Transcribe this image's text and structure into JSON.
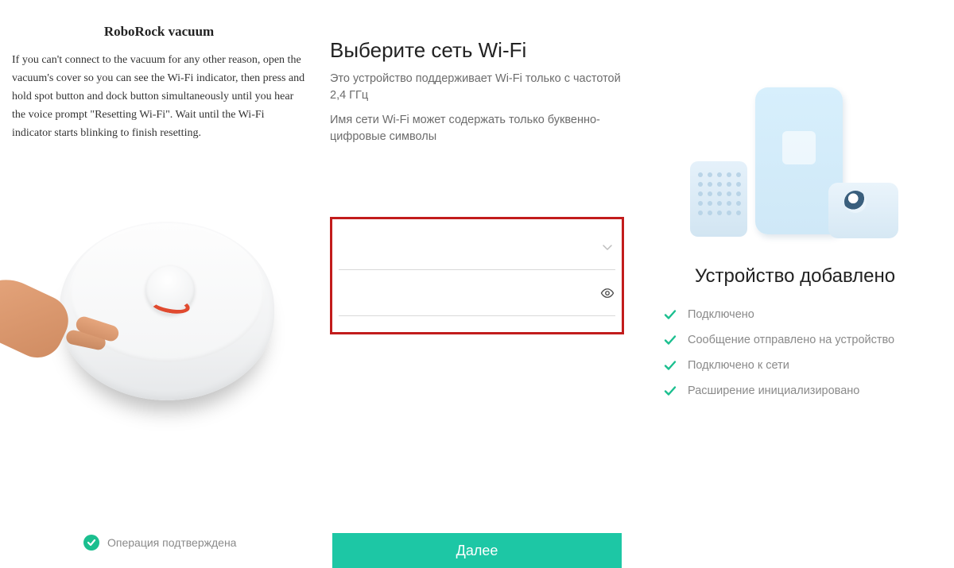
{
  "left": {
    "title": "RoboRock vacuum",
    "body": "If you can't connect to the vacuum for any other reason, open the vacuum's cover so you can see the Wi-Fi indicator, then press and hold spot button and dock button simultaneously until you hear the voice prompt \"Resetting Wi-Fi\". Wait until the Wi-Fi indicator starts blinking to finish resetting.",
    "confirm": "Операция подтверждена"
  },
  "mid": {
    "title": "Выберите сеть Wi-Fi",
    "sub1": "Это устройство поддерживает Wi-Fi только с частотой 2,4 ГГц",
    "sub2": "Имя сети Wi-Fi может содержать только буквенно-цифровые символы",
    "ssid_value": "",
    "password_value": "",
    "next": "Далее"
  },
  "right": {
    "title": "Устройство добавлено",
    "steps": [
      "Подключено",
      "Сообщение отправлено на устройство",
      "Подключено к сети",
      "Расширение инициализировано"
    ]
  },
  "colors": {
    "accent": "#1dc7a5",
    "check": "#1bbf8f",
    "highlight_border": "#c21c1c"
  }
}
